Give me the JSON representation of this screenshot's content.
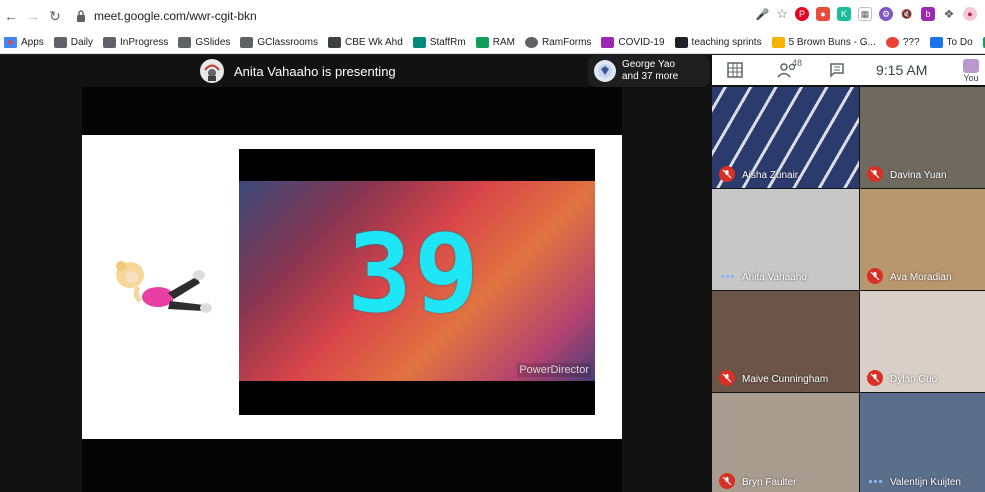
{
  "browser": {
    "url": "meet.google.com/wwr-cgit-bkn",
    "bookmarks": [
      {
        "label": "Apps",
        "color": "#4285f4",
        "kind": "apps"
      },
      {
        "label": "Daily",
        "color": "#5f6368",
        "kind": "folder"
      },
      {
        "label": "InProgress",
        "color": "#5f6368",
        "kind": "folder"
      },
      {
        "label": "GSlides",
        "color": "#5f6368",
        "kind": "folder"
      },
      {
        "label": "GClassrooms",
        "color": "#5f6368",
        "kind": "folder"
      },
      {
        "label": "CBE Wk Ahd",
        "color": "#3c4043",
        "kind": "doc"
      },
      {
        "label": "StaffRm",
        "color": "#00897b",
        "kind": "meet"
      },
      {
        "label": "RAM",
        "color": "#0f9d58",
        "kind": "sheet"
      },
      {
        "label": "RamForms",
        "color": "#5f6368",
        "kind": "globe"
      },
      {
        "label": "COVID-19",
        "color": "#9c27b0",
        "kind": "onenote"
      },
      {
        "label": "teaching sprints",
        "color": "#202124",
        "kind": "doc"
      },
      {
        "label": "5 Brown Buns - G...",
        "color": "#f4b400",
        "kind": "slides"
      },
      {
        "label": "???",
        "color": "#ea4335",
        "kind": "google"
      },
      {
        "label": "To Do",
        "color": "#1a73e8",
        "kind": "doc"
      },
      {
        "label": "TT",
        "color": "#0f9d58",
        "kind": "drive"
      }
    ]
  },
  "meet": {
    "presenting_text": "Anita Vahaaho is presenting",
    "pinned_chip": {
      "line1": "George Yao",
      "line2": "and 37 more"
    },
    "participant_count": "48",
    "clock": "9:15 AM",
    "you_label": "You",
    "slide": {
      "counter": "39",
      "watermark": "PowerDirector"
    },
    "tiles": [
      {
        "name": "Aisha Zunair",
        "muted": true,
        "bg": "#2c3b6e"
      },
      {
        "name": "Davina Yuan",
        "muted": true,
        "bg": "#6f6a60"
      },
      {
        "name": "Anita Vahaaho",
        "muted": false,
        "bg": "#c7c7c7"
      },
      {
        "name": "Ava Moradian",
        "muted": true,
        "bg": "#b8966e"
      },
      {
        "name": "Maive Cunningham",
        "muted": true,
        "bg": "#6a5548"
      },
      {
        "name": "Dylan Guo",
        "muted": true,
        "bg": "#d8d0c8"
      },
      {
        "name": "Bryn Faulter",
        "muted": true,
        "bg": "#a89c8e"
      },
      {
        "name": "Valentijn Kuijten",
        "muted": false,
        "bg": "#5b6e8a"
      }
    ]
  }
}
